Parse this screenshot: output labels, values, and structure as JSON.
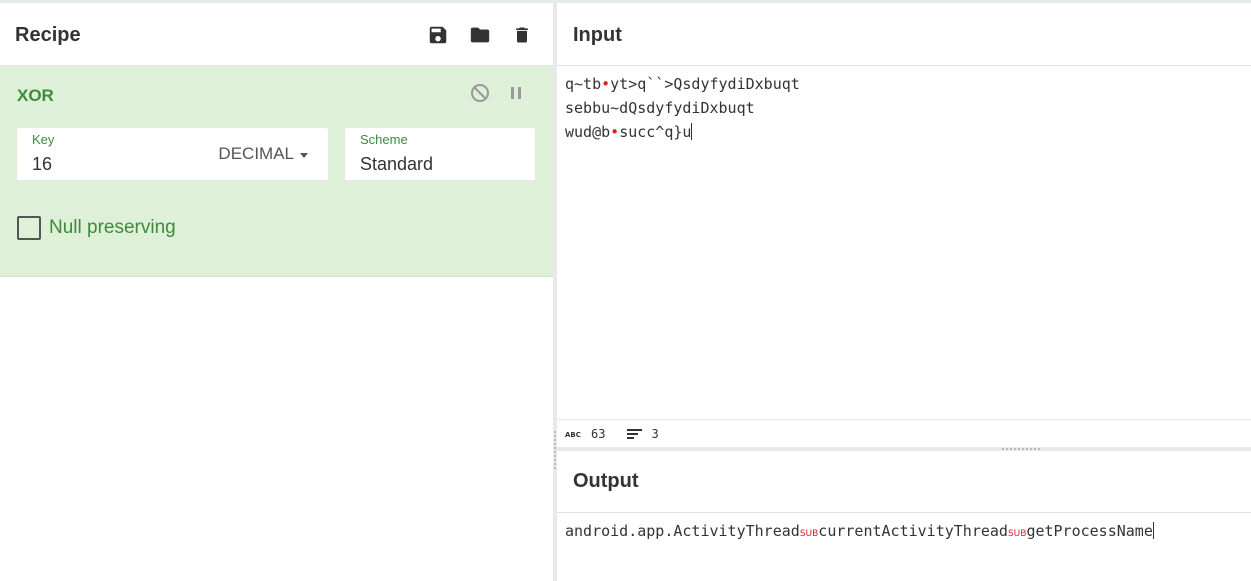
{
  "recipe": {
    "title": "Recipe",
    "icons": [
      "save-icon",
      "folder-icon",
      "trash-icon"
    ]
  },
  "operation": {
    "name": "XOR",
    "key": {
      "label": "Key",
      "value": "16",
      "format": "DECIMAL"
    },
    "scheme": {
      "label": "Scheme",
      "value": "Standard"
    },
    "null_preserving": {
      "label": "Null preserving",
      "checked": false
    }
  },
  "input": {
    "title": "Input",
    "lines": [
      {
        "a": "q~tb",
        "b": "yt>q``>QsdyfydiDxbuqt"
      },
      {
        "a": "sebbu~dQsdyfydiDxbuqt",
        "b": ""
      },
      {
        "a": "wud@b",
        "b": "succ^q}u"
      }
    ],
    "stats": {
      "chars": "63",
      "lines": "3"
    }
  },
  "output": {
    "title": "Output",
    "segments": [
      "android.app.ActivityThread",
      "currentActivityThread",
      "getProcessName"
    ],
    "sub_label": "SUB"
  },
  "colors": {
    "accent_green": "#3c8c3c",
    "op_background": "#dff0d8",
    "control_char": "#dd2222"
  }
}
